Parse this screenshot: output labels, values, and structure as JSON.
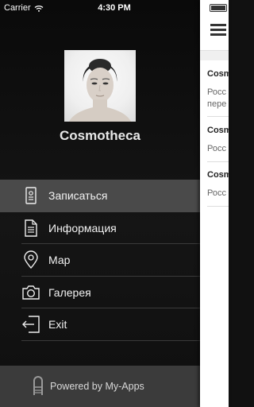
{
  "status_bar": {
    "carrier": "Carrier",
    "time": "4:30 PM"
  },
  "profile": {
    "name": "Cosmotheca"
  },
  "menu": {
    "items": [
      {
        "label": "Записаться",
        "icon": "ticket-icon"
      },
      {
        "label": "Информация",
        "icon": "document-icon"
      },
      {
        "label": "Мар",
        "icon": "map-pin-icon"
      },
      {
        "label": "Галерея",
        "icon": "camera-icon"
      },
      {
        "label": "Exit",
        "icon": "exit-icon"
      }
    ]
  },
  "footer": {
    "powered": "Powered by My-Apps"
  },
  "content_panel": {
    "items": [
      {
        "title": "Cosm",
        "subtitle": "Росс",
        "subtitle2": "пере"
      },
      {
        "title": "Cosm",
        "subtitle": "Росс"
      },
      {
        "title": "Cosm",
        "subtitle": "Росс"
      }
    ]
  },
  "colors": {
    "drawer_bg": "#111111",
    "active_item": "#4a4a4a",
    "footer_bg": "#3b3b3b"
  }
}
